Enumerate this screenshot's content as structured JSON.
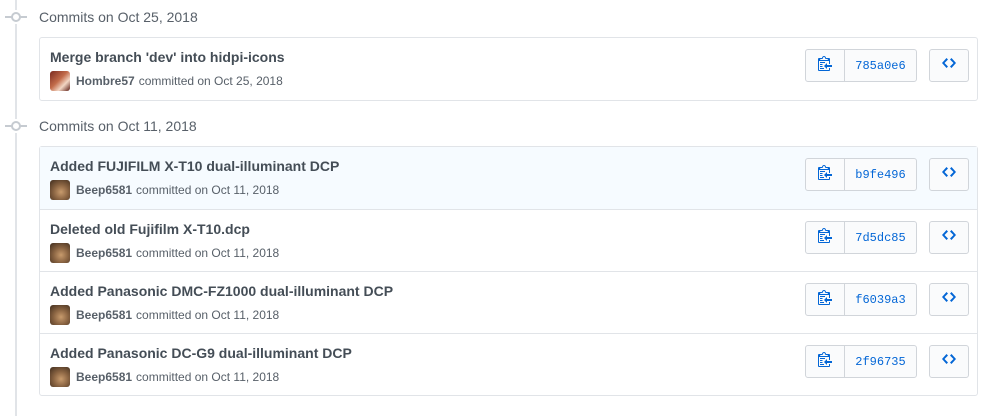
{
  "groups": [
    {
      "title": "Commits on Oct 25, 2018",
      "commits": [
        {
          "message": "Merge branch 'dev' into hidpi-icons",
          "author": "Hombre57",
          "date_text": "committed on Oct 25, 2018",
          "sha": "785a0e6",
          "avatar_icon": "avatar-hombre57"
        }
      ]
    },
    {
      "title": "Commits on Oct 11, 2018",
      "commits": [
        {
          "message": "Added FUJIFILM X-T10 dual-illuminant DCP",
          "author": "Beep6581",
          "date_text": "committed on Oct 11, 2018",
          "sha": "b9fe496",
          "avatar_icon": "avatar-beep6581"
        },
        {
          "message": "Deleted old Fujifilm X-T10.dcp",
          "author": "Beep6581",
          "date_text": "committed on Oct 11, 2018",
          "sha": "7d5dc85",
          "avatar_icon": "avatar-beep6581"
        },
        {
          "message": "Added Panasonic DMC-FZ1000 dual-illuminant DCP",
          "author": "Beep6581",
          "date_text": "committed on Oct 11, 2018",
          "sha": "f6039a3",
          "avatar_icon": "avatar-beep6581"
        },
        {
          "message": "Added Panasonic DC-G9 dual-illuminant DCP",
          "author": "Beep6581",
          "date_text": "committed on Oct 11, 2018",
          "sha": "2f96735",
          "avatar_icon": "avatar-beep6581"
        }
      ]
    }
  ],
  "icons": {
    "group_node": "git-commit-icon",
    "copy": "clippy-icon",
    "browse": "code-icon"
  },
  "colors": {
    "link_blue": "#0366d6",
    "border": "#e1e4e8",
    "highlight_row": "#f6fbff",
    "muted_text": "#586069"
  }
}
